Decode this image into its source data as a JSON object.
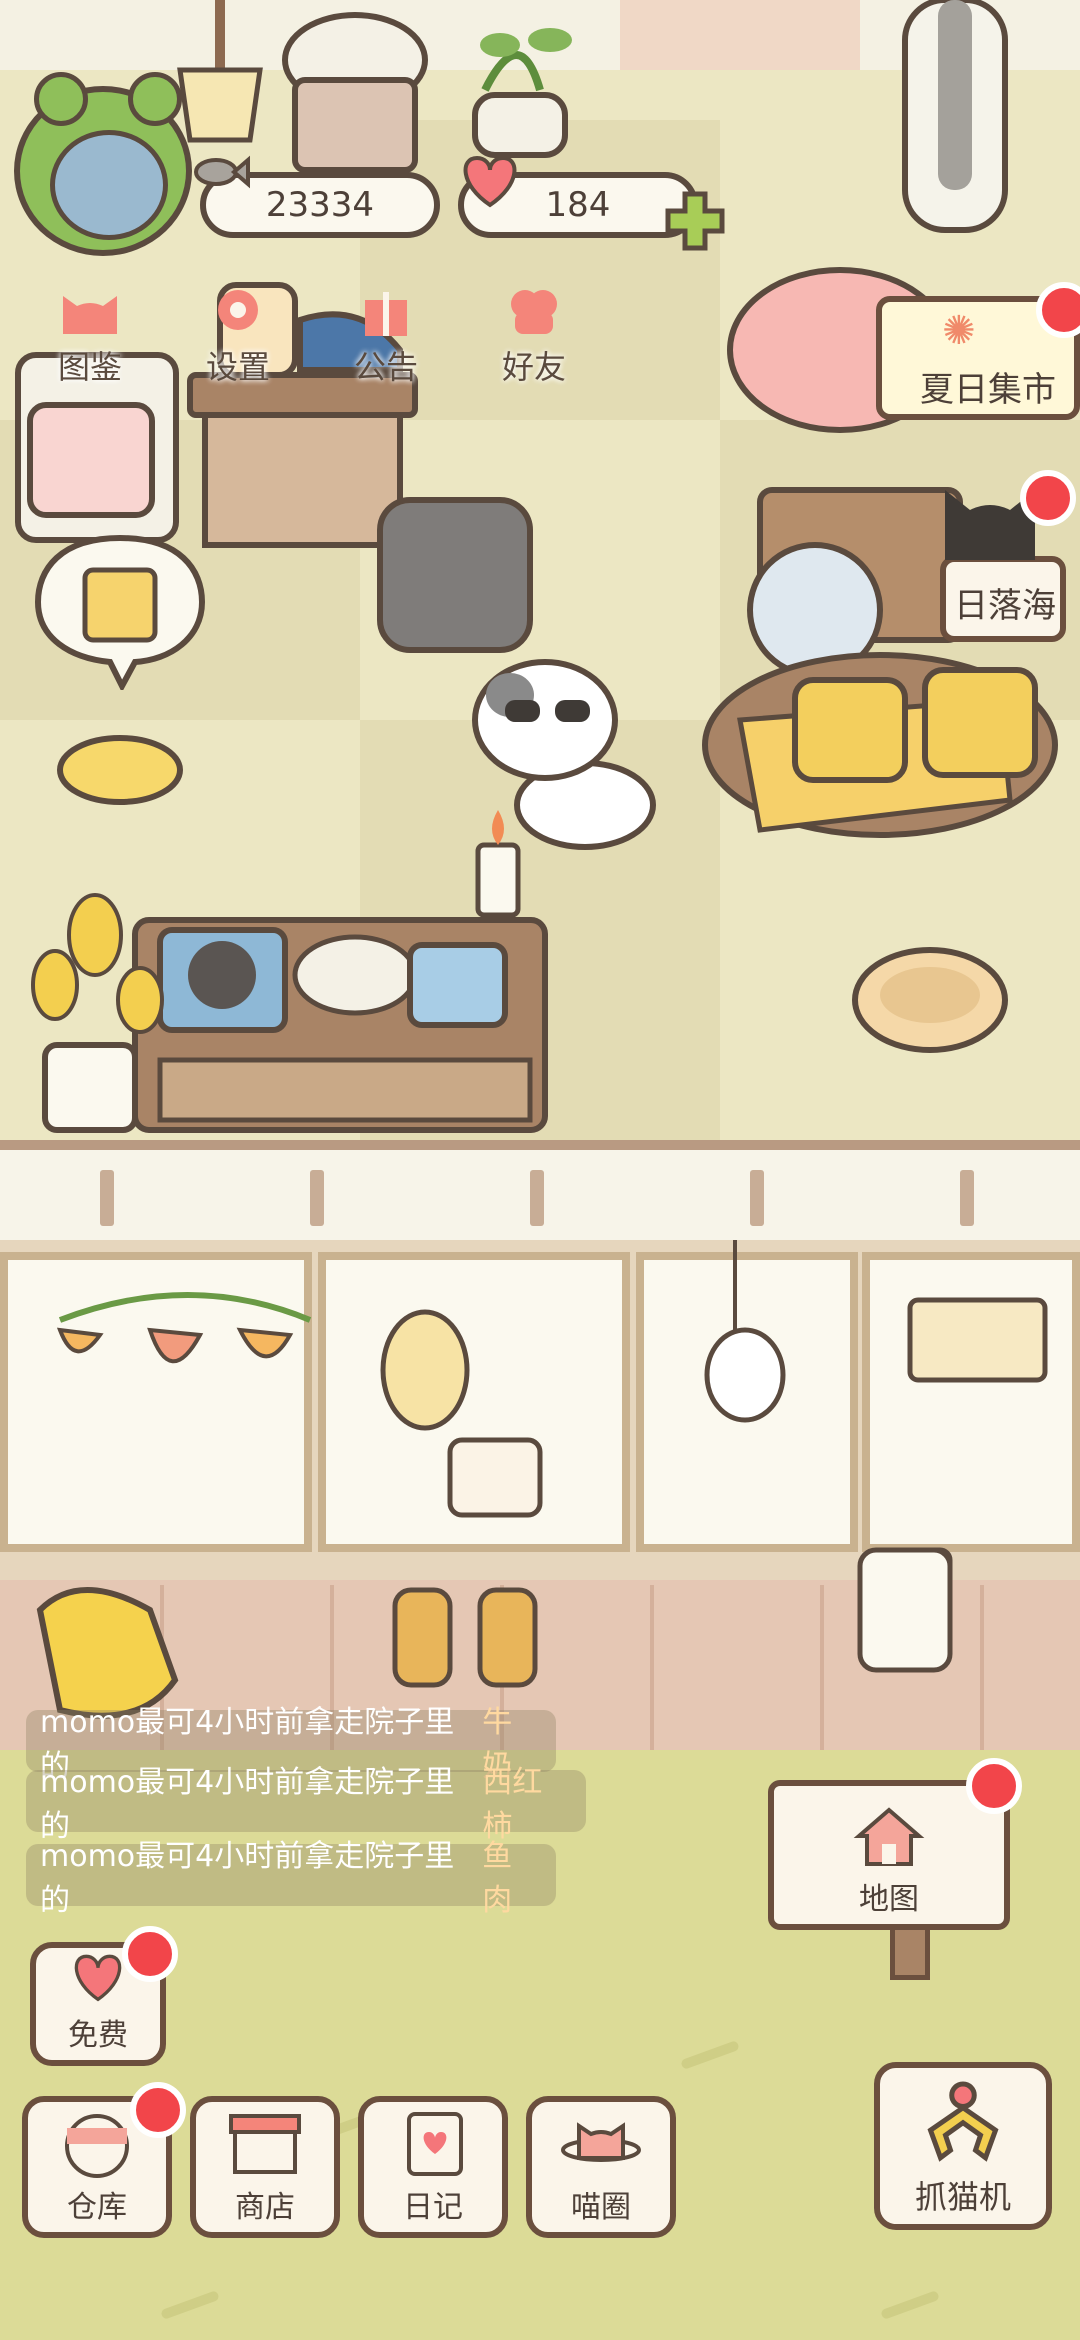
{
  "hud": {
    "coins": "23334",
    "hearts": "184"
  },
  "menu": {
    "items": [
      {
        "label": "图鉴"
      },
      {
        "label": "设置"
      },
      {
        "label": "公告"
      },
      {
        "label": "好友"
      }
    ]
  },
  "events": {
    "summer_market": "夏日集市",
    "sunset_sea": "日落海"
  },
  "activity_log": [
    {
      "prefix": "momo最可4小时前拿走院子里的",
      "item": "牛奶"
    },
    {
      "prefix": "momo最可4小时前拿走院子里的",
      "item": "西红柿"
    },
    {
      "prefix": "momo最可4小时前拿走院子里的",
      "item": "鱼肉"
    }
  ],
  "buttons": {
    "map": "地图",
    "free": "免费",
    "warehouse": "仓库",
    "shop": "商店",
    "diary": "日记",
    "cat_circle": "喵圈",
    "claw": "抓猫机"
  },
  "colors": {
    "accent_red": "#f2454a",
    "outline": "#5a4a3e",
    "room_floor": "#ece7c3",
    "yard": "#dcdb97"
  }
}
